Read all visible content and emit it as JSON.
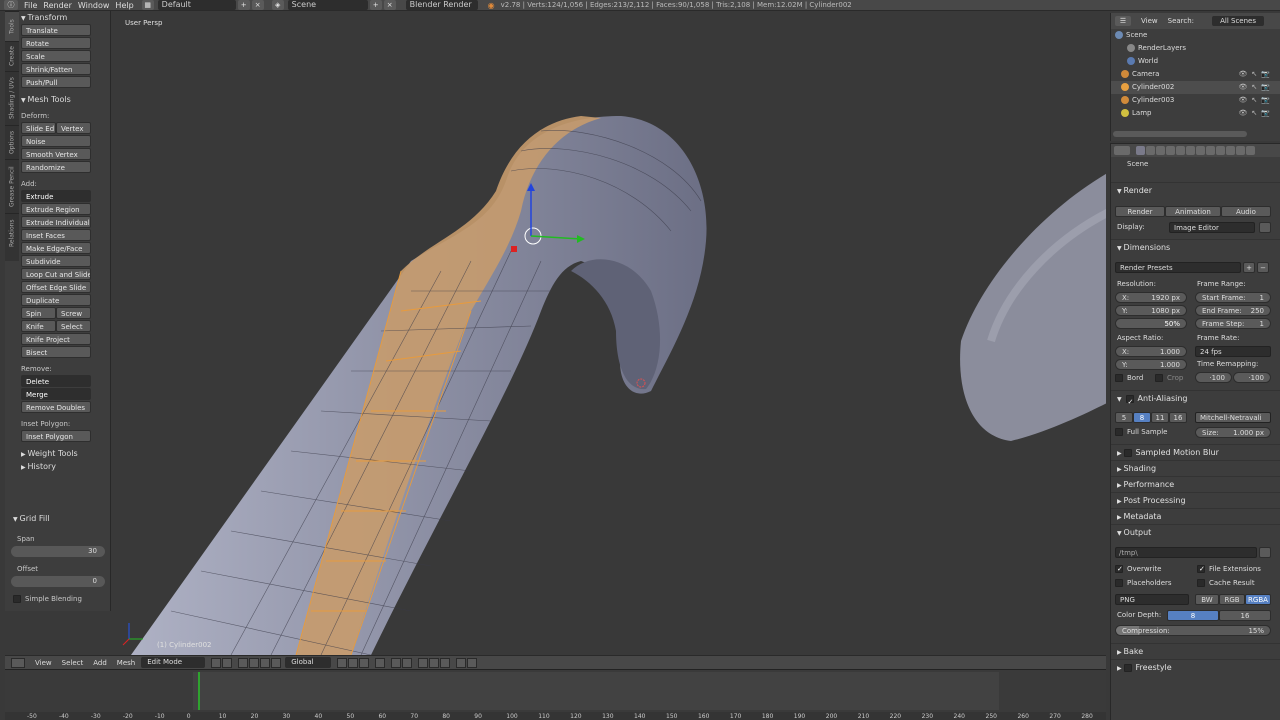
{
  "topbar": {
    "menus": [
      "File",
      "Render",
      "Window",
      "Help"
    ],
    "layout": "Default",
    "scene": "Scene",
    "engine": "Blender Render",
    "stats": "v2.78 | Verts:124/1,056 | Edges:213/2,112 | Faces:90/1,058 | Tris:2,108 | Mem:12.02M | Cylinder002"
  },
  "vtabs": [
    "Tools",
    "Create",
    "Shading / UVs",
    "Options",
    "Grease Pencil",
    "Relations"
  ],
  "toolshelf": {
    "transform": {
      "title": "Transform",
      "buttons": [
        "Translate",
        "Rotate",
        "Scale",
        "Shrink/Fatten",
        "Push/Pull"
      ]
    },
    "mesh_tools": {
      "title": "Mesh Tools",
      "deform_label": "Deform:",
      "slide_edge": "Slide Ed",
      "vertex": "Vertex",
      "noise": "Noise",
      "smooth_vertex": "Smooth Vertex",
      "randomize": "Randomize",
      "add_label": "Add:",
      "extrude": "Extrude",
      "extrude_region": "Extrude Region",
      "extrude_individual": "Extrude Individual",
      "inset_faces": "Inset Faces",
      "make_edge_face": "Make Edge/Face",
      "subdivide": "Subdivide",
      "loop_cut": "Loop Cut and Slide",
      "offset_edge": "Offset Edge Slide",
      "duplicate": "Duplicate",
      "spin": "Spin",
      "screw": "Screw",
      "knife": "Knife",
      "select": "Select",
      "knife_project": "Knife Project",
      "bisect": "Bisect",
      "remove_label": "Remove:",
      "delete": "Delete",
      "merge": "Merge",
      "remove_doubles": "Remove Doubles",
      "inset_polygon_label": "Inset Polygon:",
      "inset_polygon": "Inset Polygon"
    },
    "weight_tools": "Weight Tools",
    "history": "History",
    "grid_fill": {
      "title": "Grid Fill",
      "span_label": "Span",
      "span": "30",
      "offset_label": "Offset",
      "offset": "0",
      "simple_blending": "Simple Blending"
    }
  },
  "viewport": {
    "view_label": "User Persp",
    "object_label": "(1) Cylinder002"
  },
  "viewport_header": {
    "menus": [
      "View",
      "Select",
      "Add",
      "Mesh"
    ],
    "mode": "Edit Mode",
    "orientation": "Global"
  },
  "timeline": {
    "ticks": [
      "-50",
      "-40",
      "-30",
      "-20",
      "-10",
      "0",
      "10",
      "20",
      "30",
      "40",
      "50",
      "60",
      "70",
      "80",
      "90",
      "100",
      "110",
      "120",
      "130",
      "140",
      "150",
      "160",
      "170",
      "180",
      "190",
      "200",
      "210",
      "220",
      "230",
      "240",
      "250",
      "260",
      "270",
      "280"
    ],
    "current_frame": 0,
    "start": 1,
    "end": 250
  },
  "outliner": {
    "view": "View",
    "search": "Search:",
    "filter": "All Scenes",
    "rows": [
      "Scene",
      "RenderLayers",
      "World",
      "Camera",
      "Cylinder002",
      "Cylinder003",
      "Lamp"
    ]
  },
  "properties": {
    "breadcrumb": "Scene",
    "render": {
      "title": "Render",
      "render_btn": "Render",
      "animation_btn": "Animation",
      "audio_btn": "Audio",
      "display_label": "Display:",
      "display": "Image Editor"
    },
    "dimensions": {
      "title": "Dimensions",
      "presets": "Render Presets",
      "resolution_label": "Resolution:",
      "res_x": "X:",
      "res_x_val": "1920 px",
      "res_y": "Y:",
      "res_y_val": "1080 px",
      "res_pct": "50%",
      "frame_range_label": "Frame Range:",
      "start_frame": "Start Frame:",
      "start_frame_val": "1",
      "end_frame": "End Frame:",
      "end_frame_val": "250",
      "frame_step": "Frame Step:",
      "frame_step_val": "1",
      "aspect_label": "Aspect Ratio:",
      "asp_x": "X:",
      "asp_x_val": "1.000",
      "asp_y": "Y:",
      "asp_y_val": "1.000",
      "frame_rate_label": "Frame Rate:",
      "frame_rate": "24 fps",
      "time_remap_label": "Time Remapping:",
      "remap_old": "·100",
      "remap_new": "·100",
      "bord": "Bord",
      "crop": "Crop"
    },
    "aa": {
      "title": "Anti-Aliasing",
      "samples": [
        "5",
        "8",
        "11",
        "16"
      ],
      "filter": "Mitchell-Netravali",
      "full_sample": "Full Sample",
      "size": "Size:",
      "size_val": "1.000 px"
    },
    "collapsed": [
      "Sampled Motion Blur",
      "Shading",
      "Performance",
      "Post Processing",
      "Metadata"
    ],
    "output": {
      "title": "Output",
      "path": "/tmp\\",
      "overwrite": "Overwrite",
      "file_extensions": "File Extensions",
      "placeholders": "Placeholders",
      "cache_result": "Cache Result",
      "format": "PNG",
      "bw": "BW",
      "rgb": "RGB",
      "rgba": "RGBA",
      "color_depth": "Color Depth:",
      "depth_8": "8",
      "depth_16": "16",
      "compression": "Compression:",
      "compression_val": "15%"
    },
    "bake": "Bake",
    "freestyle": "Freestyle"
  }
}
